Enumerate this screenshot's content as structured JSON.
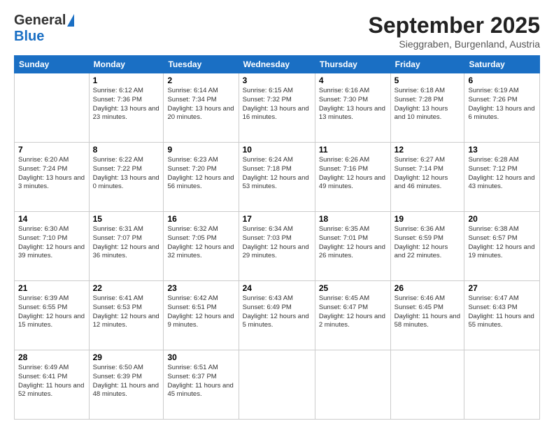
{
  "header": {
    "logo_general": "General",
    "logo_blue": "Blue",
    "title": "September 2025",
    "subtitle": "Sieggraben, Burgenland, Austria"
  },
  "calendar": {
    "days_of_week": [
      "Sunday",
      "Monday",
      "Tuesday",
      "Wednesday",
      "Thursday",
      "Friday",
      "Saturday"
    ],
    "weeks": [
      [
        {
          "day": "",
          "info": ""
        },
        {
          "day": "1",
          "info": "Sunrise: 6:12 AM\nSunset: 7:36 PM\nDaylight: 13 hours and 23 minutes."
        },
        {
          "day": "2",
          "info": "Sunrise: 6:14 AM\nSunset: 7:34 PM\nDaylight: 13 hours and 20 minutes."
        },
        {
          "day": "3",
          "info": "Sunrise: 6:15 AM\nSunset: 7:32 PM\nDaylight: 13 hours and 16 minutes."
        },
        {
          "day": "4",
          "info": "Sunrise: 6:16 AM\nSunset: 7:30 PM\nDaylight: 13 hours and 13 minutes."
        },
        {
          "day": "5",
          "info": "Sunrise: 6:18 AM\nSunset: 7:28 PM\nDaylight: 13 hours and 10 minutes."
        },
        {
          "day": "6",
          "info": "Sunrise: 6:19 AM\nSunset: 7:26 PM\nDaylight: 13 hours and 6 minutes."
        }
      ],
      [
        {
          "day": "7",
          "info": "Sunrise: 6:20 AM\nSunset: 7:24 PM\nDaylight: 13 hours and 3 minutes."
        },
        {
          "day": "8",
          "info": "Sunrise: 6:22 AM\nSunset: 7:22 PM\nDaylight: 13 hours and 0 minutes."
        },
        {
          "day": "9",
          "info": "Sunrise: 6:23 AM\nSunset: 7:20 PM\nDaylight: 12 hours and 56 minutes."
        },
        {
          "day": "10",
          "info": "Sunrise: 6:24 AM\nSunset: 7:18 PM\nDaylight: 12 hours and 53 minutes."
        },
        {
          "day": "11",
          "info": "Sunrise: 6:26 AM\nSunset: 7:16 PM\nDaylight: 12 hours and 49 minutes."
        },
        {
          "day": "12",
          "info": "Sunrise: 6:27 AM\nSunset: 7:14 PM\nDaylight: 12 hours and 46 minutes."
        },
        {
          "day": "13",
          "info": "Sunrise: 6:28 AM\nSunset: 7:12 PM\nDaylight: 12 hours and 43 minutes."
        }
      ],
      [
        {
          "day": "14",
          "info": "Sunrise: 6:30 AM\nSunset: 7:10 PM\nDaylight: 12 hours and 39 minutes."
        },
        {
          "day": "15",
          "info": "Sunrise: 6:31 AM\nSunset: 7:07 PM\nDaylight: 12 hours and 36 minutes."
        },
        {
          "day": "16",
          "info": "Sunrise: 6:32 AM\nSunset: 7:05 PM\nDaylight: 12 hours and 32 minutes."
        },
        {
          "day": "17",
          "info": "Sunrise: 6:34 AM\nSunset: 7:03 PM\nDaylight: 12 hours and 29 minutes."
        },
        {
          "day": "18",
          "info": "Sunrise: 6:35 AM\nSunset: 7:01 PM\nDaylight: 12 hours and 26 minutes."
        },
        {
          "day": "19",
          "info": "Sunrise: 6:36 AM\nSunset: 6:59 PM\nDaylight: 12 hours and 22 minutes."
        },
        {
          "day": "20",
          "info": "Sunrise: 6:38 AM\nSunset: 6:57 PM\nDaylight: 12 hours and 19 minutes."
        }
      ],
      [
        {
          "day": "21",
          "info": "Sunrise: 6:39 AM\nSunset: 6:55 PM\nDaylight: 12 hours and 15 minutes."
        },
        {
          "day": "22",
          "info": "Sunrise: 6:41 AM\nSunset: 6:53 PM\nDaylight: 12 hours and 12 minutes."
        },
        {
          "day": "23",
          "info": "Sunrise: 6:42 AM\nSunset: 6:51 PM\nDaylight: 12 hours and 9 minutes."
        },
        {
          "day": "24",
          "info": "Sunrise: 6:43 AM\nSunset: 6:49 PM\nDaylight: 12 hours and 5 minutes."
        },
        {
          "day": "25",
          "info": "Sunrise: 6:45 AM\nSunset: 6:47 PM\nDaylight: 12 hours and 2 minutes."
        },
        {
          "day": "26",
          "info": "Sunrise: 6:46 AM\nSunset: 6:45 PM\nDaylight: 11 hours and 58 minutes."
        },
        {
          "day": "27",
          "info": "Sunrise: 6:47 AM\nSunset: 6:43 PM\nDaylight: 11 hours and 55 minutes."
        }
      ],
      [
        {
          "day": "28",
          "info": "Sunrise: 6:49 AM\nSunset: 6:41 PM\nDaylight: 11 hours and 52 minutes."
        },
        {
          "day": "29",
          "info": "Sunrise: 6:50 AM\nSunset: 6:39 PM\nDaylight: 11 hours and 48 minutes."
        },
        {
          "day": "30",
          "info": "Sunrise: 6:51 AM\nSunset: 6:37 PM\nDaylight: 11 hours and 45 minutes."
        },
        {
          "day": "",
          "info": ""
        },
        {
          "day": "",
          "info": ""
        },
        {
          "day": "",
          "info": ""
        },
        {
          "day": "",
          "info": ""
        }
      ]
    ]
  }
}
